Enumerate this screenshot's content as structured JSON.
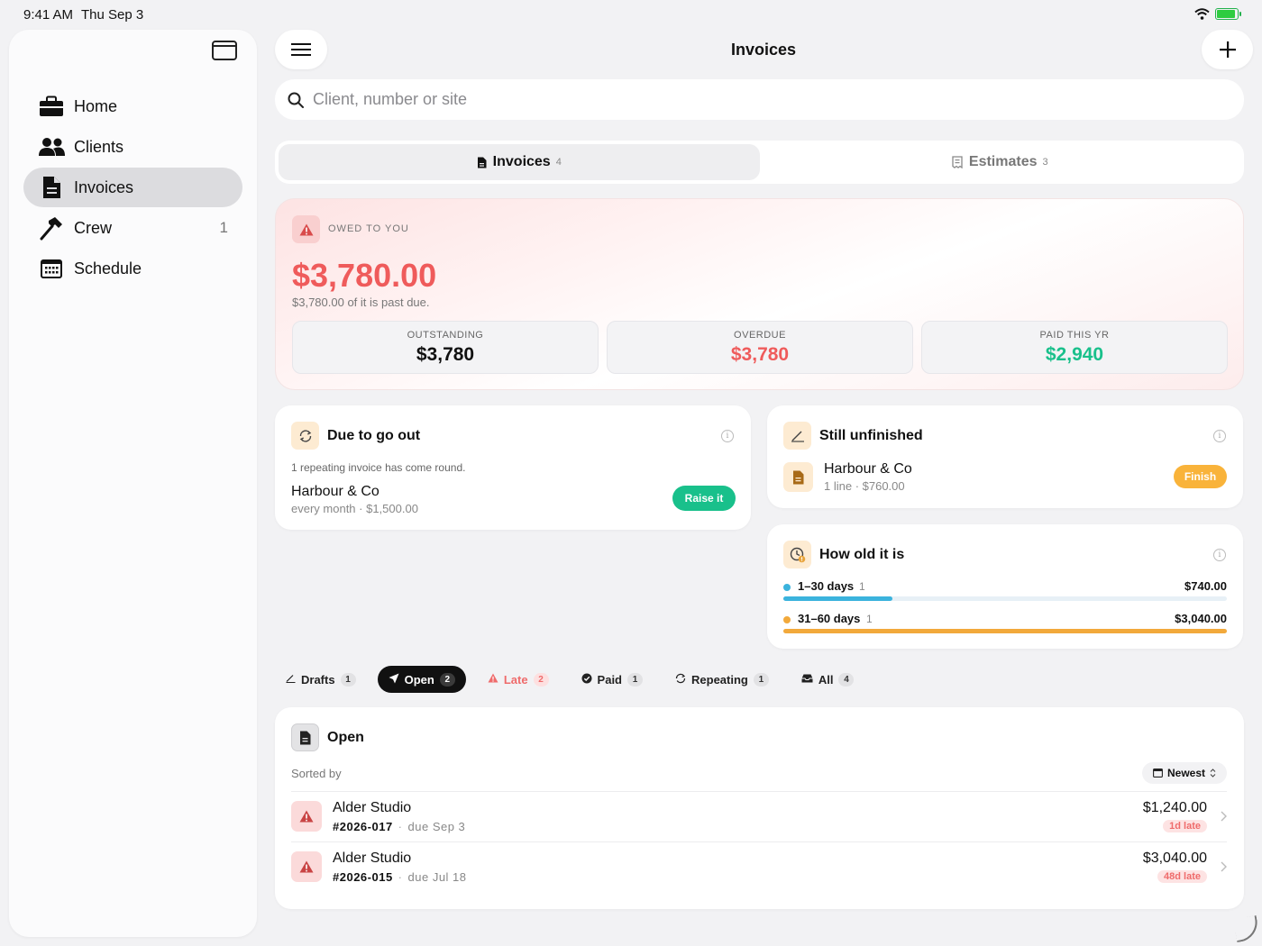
{
  "status": {
    "time": "9:41 AM",
    "date": "Thu Sep 3"
  },
  "sidebar": {
    "items": [
      {
        "label": "Home",
        "icon": "briefcase-icon",
        "count": ""
      },
      {
        "label": "Clients",
        "icon": "people-icon",
        "count": ""
      },
      {
        "label": "Invoices",
        "icon": "document-icon",
        "count": "",
        "active": true
      },
      {
        "label": "Crew",
        "icon": "hammer-icon",
        "count": "1"
      },
      {
        "label": "Schedule",
        "icon": "calendar-icon",
        "count": ""
      }
    ]
  },
  "header": {
    "title": "Invoices"
  },
  "search": {
    "placeholder": "Client, number or site"
  },
  "tabs": {
    "invoices": {
      "label": "Invoices",
      "count": "4"
    },
    "estimates": {
      "label": "Estimates",
      "count": "3"
    }
  },
  "owed": {
    "label": "OWED TO YOU",
    "amount": "$3,780.00",
    "subtitle": "$3,780.00 of it is past due.",
    "stats": [
      {
        "label": "OUTSTANDING",
        "value": "$3,780",
        "color": "#111111"
      },
      {
        "label": "OVERDUE",
        "value": "$3,780",
        "color": "#ef5b5b"
      },
      {
        "label": "PAID THIS YR",
        "value": "$2,940",
        "color": "#19c08b"
      }
    ]
  },
  "due": {
    "title": "Due to go out",
    "description": "1 repeating invoice has come round.",
    "client": "Harbour & Co",
    "meta": "every month · $1,500.00",
    "button": "Raise it"
  },
  "unfinished": {
    "title": "Still unfinished",
    "client": "Harbour & Co",
    "meta": "1 line · $760.00",
    "button": "Finish"
  },
  "aging": {
    "title": "How old it is",
    "buckets": [
      {
        "label": "1–30 days",
        "count": "1",
        "amount": "$740.00",
        "color": "#3bb3dd",
        "fraction": 0.245
      },
      {
        "label": "31–60 days",
        "count": "1",
        "amount": "$3,040.00",
        "color": "#f2a93b",
        "fraction": 1.0
      }
    ]
  },
  "filters": [
    {
      "label": "Drafts",
      "count": "1",
      "icon": "pencil-icon"
    },
    {
      "label": "Open",
      "count": "2",
      "icon": "send-icon",
      "active": true
    },
    {
      "label": "Late",
      "count": "2",
      "icon": "warning-icon",
      "late": true
    },
    {
      "label": "Paid",
      "count": "1",
      "icon": "check-badge-icon"
    },
    {
      "label": "Repeating",
      "count": "1",
      "icon": "repeat-icon"
    },
    {
      "label": "All",
      "count": "4",
      "icon": "tray-icon"
    }
  ],
  "open": {
    "title": "Open",
    "sorted_label": "Sorted by",
    "sort_value": "Newest",
    "rows": [
      {
        "client": "Alder Studio",
        "number": "#2026-017",
        "due": "due Sep 3",
        "amount": "$1,240.00",
        "late": "1d late"
      },
      {
        "client": "Alder Studio",
        "number": "#2026-015",
        "due": "due Jul 18",
        "amount": "$3,040.00",
        "late": "48d late"
      }
    ]
  }
}
